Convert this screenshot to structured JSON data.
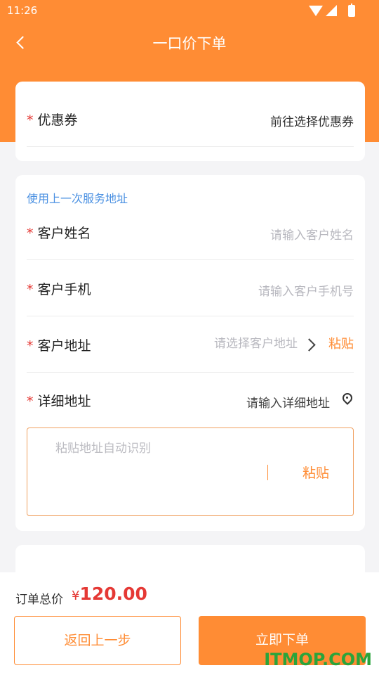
{
  "status_bar": {
    "time": "11:26"
  },
  "nav": {
    "title": "一口价下单"
  },
  "coupon": {
    "required_mark": "*",
    "label": "优惠券",
    "value": "前往选择优惠券"
  },
  "address": {
    "use_last_link": "使用上一次服务地址",
    "name": {
      "required_mark": "*",
      "label": "客户姓名",
      "placeholder": "请输入客户姓名"
    },
    "phone": {
      "required_mark": "*",
      "label": "客户手机",
      "placeholder": "请输入客户手机号"
    },
    "region": {
      "required_mark": "*",
      "label": "客户地址",
      "placeholder": "请选择客户地址",
      "paste_label": "粘贴"
    },
    "detail": {
      "required_mark": "*",
      "label": "详细地址",
      "value": "请输入详细地址"
    },
    "paste_box": {
      "placeholder": "粘贴地址自动识别",
      "button_label": "粘贴"
    }
  },
  "footer": {
    "total_label": "订单总价",
    "currency": "¥",
    "total_value": "120.00",
    "back_label": "返回上一步",
    "order_label": "立即下单"
  },
  "watermark": "ITMOP.COM",
  "colors": {
    "brand": "#ff8c34",
    "price": "#e53935",
    "link": "#4a90e2"
  }
}
